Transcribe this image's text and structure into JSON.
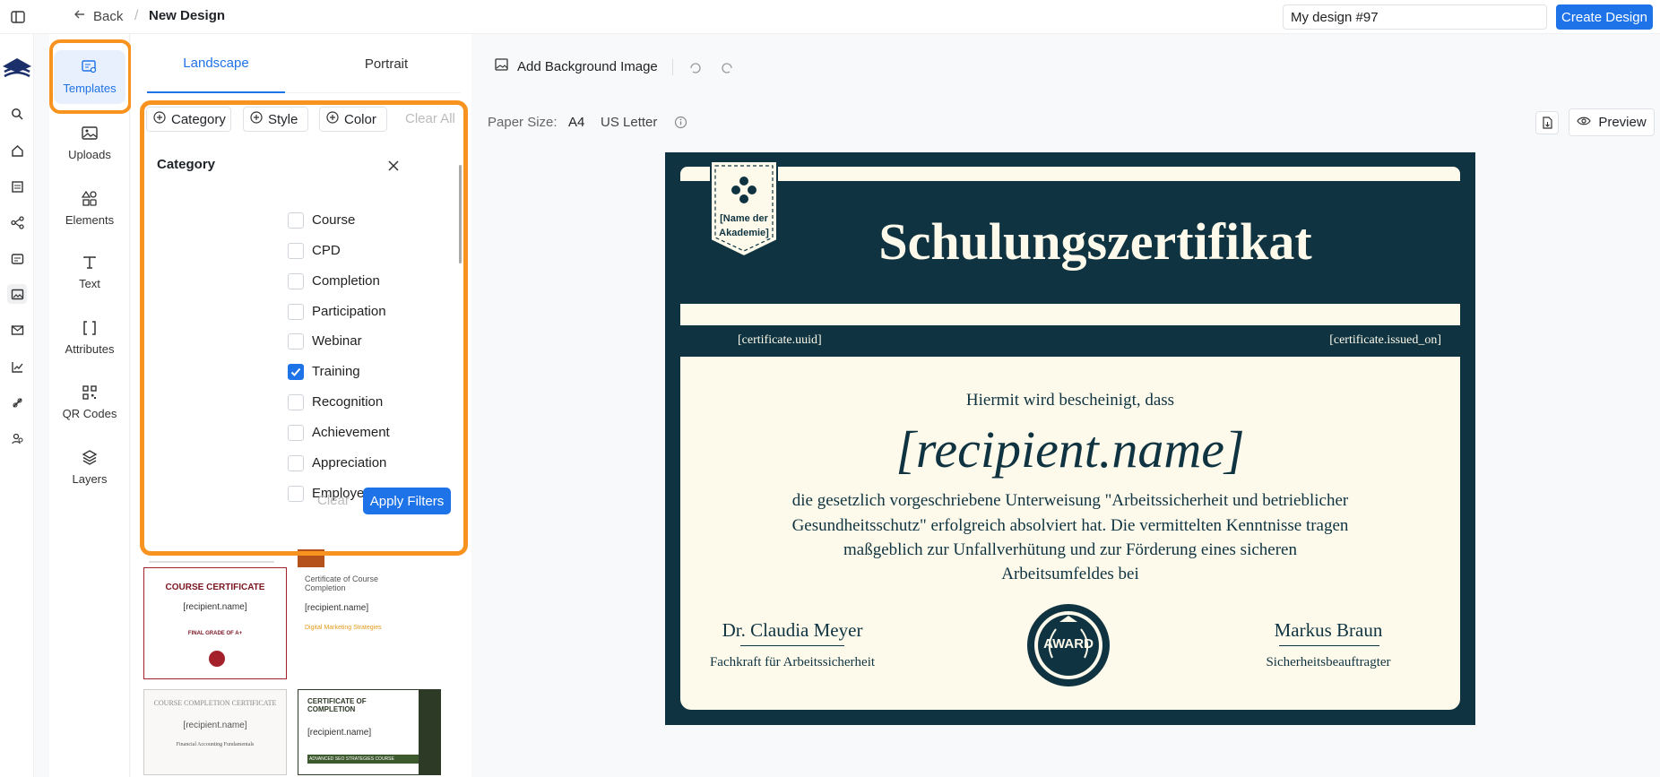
{
  "topbar": {
    "back_label": "Back",
    "separator": "/",
    "title": "New Design",
    "design_name_value": "My design #97",
    "create_button": "Create Design"
  },
  "tools": [
    {
      "label": "Templates",
      "icon": "templates-icon"
    },
    {
      "label": "Uploads",
      "icon": "image-icon"
    },
    {
      "label": "Elements",
      "icon": "shapes-icon"
    },
    {
      "label": "Text",
      "icon": "text-icon"
    },
    {
      "label": "Attributes",
      "icon": "brackets-icon"
    },
    {
      "label": "QR Codes",
      "icon": "qr-icon"
    },
    {
      "label": "Layers",
      "icon": "layers-icon"
    }
  ],
  "orientation_tabs": {
    "landscape": "Landscape",
    "portrait": "Portrait"
  },
  "filters": {
    "category": "Category",
    "style": "Style",
    "color": "Color",
    "clear_all": "Clear All"
  },
  "category_dropdown": {
    "title": "Category",
    "items": [
      {
        "label": "Course",
        "checked": false
      },
      {
        "label": "CPD",
        "checked": false
      },
      {
        "label": "Completion",
        "checked": false
      },
      {
        "label": "Participation",
        "checked": false
      },
      {
        "label": "Webinar",
        "checked": false
      },
      {
        "label": "Training",
        "checked": true
      },
      {
        "label": "Recognition",
        "checked": false
      },
      {
        "label": "Achievement",
        "checked": false
      },
      {
        "label": "Appreciation",
        "checked": false
      },
      {
        "label": "Employee of the Month",
        "checked": false
      }
    ],
    "clear": "Clear",
    "apply": "Apply Filters"
  },
  "toolbar": {
    "add_bg": "Add Background Image",
    "paper_size_label": "Paper Size:",
    "paper_a4": "A4",
    "paper_letter": "US Letter",
    "preview": "Preview"
  },
  "thumbnails": [
    {
      "title": "COURSE CERTIFICATE",
      "name": "[recipient.name]",
      "footer": "FINAL GRADE OF A+"
    },
    {
      "title": "Certificate of Course Completion",
      "name": "[recipient.name]",
      "footer": "Digital Marketing Strategies"
    },
    {
      "title": "COURSE COMPLETION CERTIFICATE",
      "name": "[recipient.name]",
      "footer": "Financial Accounting Fundamentals"
    },
    {
      "title": "CERTIFICATE OF COMPLETION",
      "name": "[recipient.name]",
      "footer": "ADVANCED SEO STRATEGIES COURSE"
    }
  ],
  "certificate": {
    "badge_text": "[Name der Akademie]",
    "title": "Schulungszertifikat",
    "uuid": "[certificate.uuid]",
    "issued_on": "[certificate.issued_on]",
    "intro": "Hiermit wird bescheinigt, dass",
    "recipient": "[recipient.name]",
    "body_lines": [
      "die gesetzlich vorgeschriebene Unterweisung \"Arbeitssicherheit und betrieblicher",
      "Gesundheitsschutz\" erfolgreich absolviert hat. Die vermittelten Kenntnisse tragen",
      "maßgeblich zur Unfallverhütung und zur Förderung eines sicheren",
      "Arbeitsumfeldes bei"
    ],
    "signer1_name": "Dr. Claudia Meyer",
    "signer1_role": "Fachkraft für Arbeitssicherheit",
    "award": "AWARD",
    "signer2_name": "Markus Braun",
    "signer2_role": "Sicherheitsbeauftragter"
  },
  "colors": {
    "accent": "#1e73e8",
    "highlight": "#f7931e",
    "certificate_dark": "#0f3340",
    "certificate_cream": "#fdfaeb"
  }
}
